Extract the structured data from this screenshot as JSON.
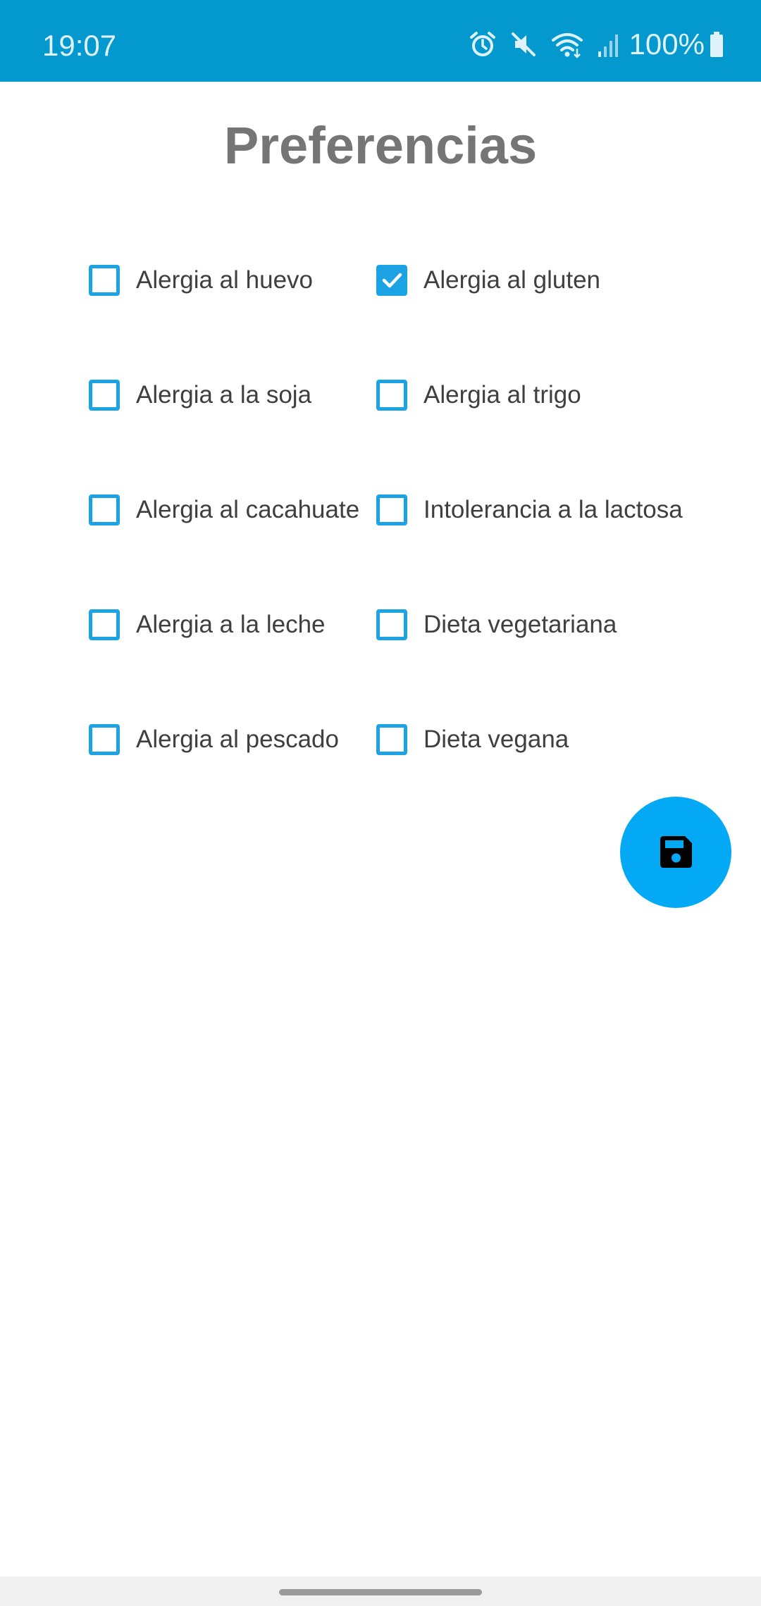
{
  "status_bar": {
    "time": "19:07",
    "battery_percent": "100%",
    "icons": [
      "alarm-icon",
      "mute-icon",
      "wifi-icon",
      "signal-icon",
      "battery-icon"
    ],
    "background_color": "#0399CE"
  },
  "page": {
    "title": "Preferencias"
  },
  "options": [
    {
      "label": "Alergia al huevo",
      "checked": false
    },
    {
      "label": "Alergia al gluten",
      "checked": true
    },
    {
      "label": "Alergia a la soja",
      "checked": false
    },
    {
      "label": "Alergia al trigo",
      "checked": false
    },
    {
      "label": "Alergia al cacahuate",
      "checked": false
    },
    {
      "label": "Intolerancia a la lactosa",
      "checked": false
    },
    {
      "label": "Alergia a la leche",
      "checked": false
    },
    {
      "label": "Dieta vegetariana",
      "checked": false
    },
    {
      "label": "Alergia al pescado",
      "checked": false
    },
    {
      "label": "Dieta vegana",
      "checked": false
    }
  ],
  "fab": {
    "icon": "save-icon",
    "color": "#03A9F4"
  },
  "accent_color": "#1BA3E5"
}
